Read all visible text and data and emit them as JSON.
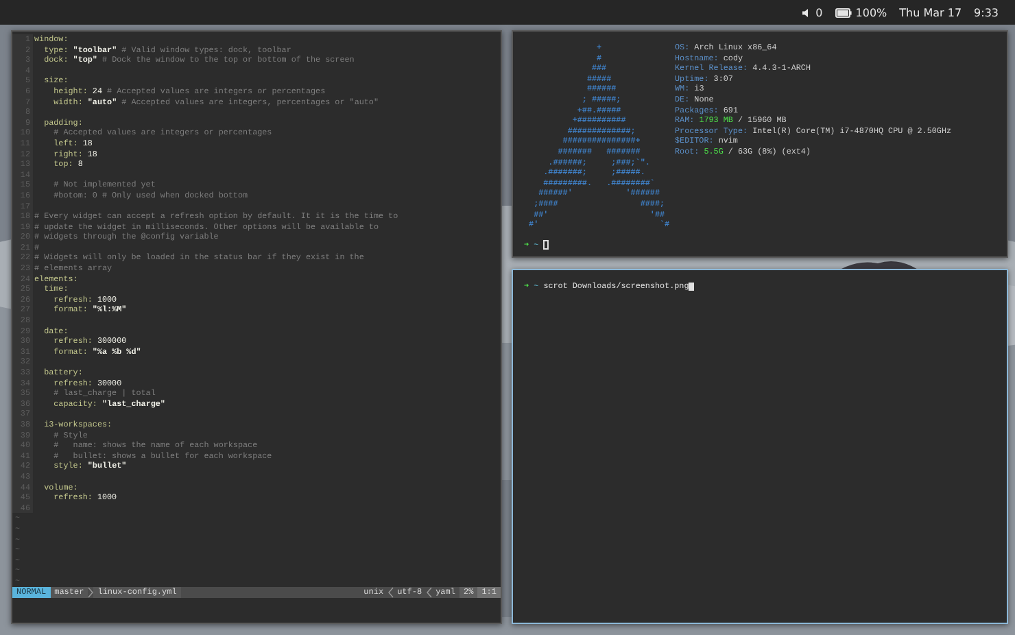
{
  "top_bar": {
    "volume": "0",
    "battery": "100%",
    "date": "Thu Mar 17",
    "time": "9:33"
  },
  "editor": {
    "lines": [
      {
        "number": "1",
        "parts": [
          {
            "kind": "key",
            "text": "window:"
          }
        ]
      },
      {
        "number": "2",
        "parts": [
          {
            "kind": "key",
            "text": "  type:"
          },
          {
            "kind": "str",
            "text": " \"toolbar\""
          },
          {
            "kind": "com",
            "text": " # Valid window types: dock, toolbar"
          }
        ]
      },
      {
        "number": "3",
        "parts": [
          {
            "kind": "key",
            "text": "  dock:"
          },
          {
            "kind": "str",
            "text": " \"top\""
          },
          {
            "kind": "com",
            "text": " # Dock the window to the top or bottom of the screen"
          }
        ]
      },
      {
        "number": "4"
      },
      {
        "number": "5",
        "parts": [
          {
            "kind": "key",
            "text": "  size:"
          }
        ]
      },
      {
        "number": "6",
        "parts": [
          {
            "kind": "key",
            "text": "    height:"
          },
          {
            "kind": "num",
            "text": " 24"
          },
          {
            "kind": "com",
            "text": " # Accepted values are integers or percentages"
          }
        ]
      },
      {
        "number": "7",
        "parts": [
          {
            "kind": "key",
            "text": "    width:"
          },
          {
            "kind": "str",
            "text": " \"auto\""
          },
          {
            "kind": "com",
            "text": " # Accepted values are integers, percentages or \"auto\""
          }
        ]
      },
      {
        "number": "8"
      },
      {
        "number": "9",
        "parts": [
          {
            "kind": "key",
            "text": "  padding:"
          }
        ]
      },
      {
        "number": "10",
        "parts": [
          {
            "kind": "com",
            "text": "    # Accepted values are integers or percentages"
          }
        ]
      },
      {
        "number": "11",
        "parts": [
          {
            "kind": "key",
            "text": "    left:"
          },
          {
            "kind": "num",
            "text": " 18"
          }
        ]
      },
      {
        "number": "12",
        "parts": [
          {
            "kind": "key",
            "text": "    right:"
          },
          {
            "kind": "num",
            "text": " 18"
          }
        ]
      },
      {
        "number": "13",
        "parts": [
          {
            "kind": "key",
            "text": "    top:"
          },
          {
            "kind": "num",
            "text": " 8"
          }
        ]
      },
      {
        "number": "14"
      },
      {
        "number": "15",
        "parts": [
          {
            "kind": "com",
            "text": "    # Not implemented yet"
          }
        ]
      },
      {
        "number": "16",
        "parts": [
          {
            "kind": "com",
            "text": "    #botom: 0 # Only used when docked bottom"
          }
        ]
      },
      {
        "number": "17"
      },
      {
        "number": "18",
        "parts": [
          {
            "kind": "com",
            "text": "# Every widget can accept a refresh option by default. It it is the time to"
          }
        ]
      },
      {
        "number": "19",
        "parts": [
          {
            "kind": "com",
            "text": "# update the widget in milliseconds. Other options will be available to"
          }
        ]
      },
      {
        "number": "20",
        "parts": [
          {
            "kind": "com",
            "text": "# widgets through the @config variable"
          }
        ]
      },
      {
        "number": "21",
        "parts": [
          {
            "kind": "com",
            "text": "#"
          }
        ]
      },
      {
        "number": "22",
        "parts": [
          {
            "kind": "com",
            "text": "# Widgets will only be loaded in the status bar if they exist in the"
          }
        ]
      },
      {
        "number": "23",
        "parts": [
          {
            "kind": "com",
            "text": "# elements array"
          }
        ]
      },
      {
        "number": "24",
        "parts": [
          {
            "kind": "key",
            "text": "elements:"
          }
        ]
      },
      {
        "number": "25",
        "parts": [
          {
            "kind": "key",
            "text": "  time:"
          }
        ]
      },
      {
        "number": "26",
        "parts": [
          {
            "kind": "key",
            "text": "    refresh:"
          },
          {
            "kind": "num",
            "text": " 1000"
          }
        ]
      },
      {
        "number": "27",
        "parts": [
          {
            "kind": "key",
            "text": "    format:"
          },
          {
            "kind": "str",
            "text": " \"%l:%M\""
          }
        ]
      },
      {
        "number": "28"
      },
      {
        "number": "29",
        "parts": [
          {
            "kind": "key",
            "text": "  date:"
          }
        ]
      },
      {
        "number": "30",
        "parts": [
          {
            "kind": "key",
            "text": "    refresh:"
          },
          {
            "kind": "num",
            "text": " 300000"
          }
        ]
      },
      {
        "number": "31",
        "parts": [
          {
            "kind": "key",
            "text": "    format:"
          },
          {
            "kind": "str",
            "text": " \"%a %b %d\""
          }
        ]
      },
      {
        "number": "32"
      },
      {
        "number": "33",
        "parts": [
          {
            "kind": "key",
            "text": "  battery:"
          }
        ]
      },
      {
        "number": "34",
        "parts": [
          {
            "kind": "key",
            "text": "    refresh:"
          },
          {
            "kind": "num",
            "text": " 30000"
          }
        ]
      },
      {
        "number": "35",
        "parts": [
          {
            "kind": "com",
            "text": "    # last_charge | total"
          }
        ]
      },
      {
        "number": "36",
        "parts": [
          {
            "kind": "key",
            "text": "    capacity:"
          },
          {
            "kind": "str",
            "text": " \"last_charge\""
          }
        ]
      },
      {
        "number": "37"
      },
      {
        "number": "38",
        "parts": [
          {
            "kind": "key",
            "text": "  i3-workspaces:"
          }
        ]
      },
      {
        "number": "39",
        "parts": [
          {
            "kind": "com",
            "text": "    # Style"
          }
        ]
      },
      {
        "number": "40",
        "parts": [
          {
            "kind": "com",
            "text": "    #   name: shows the name of each workspace"
          }
        ]
      },
      {
        "number": "41",
        "parts": [
          {
            "kind": "com",
            "text": "    #   bullet: shows a bullet for each workspace"
          }
        ]
      },
      {
        "number": "42",
        "parts": [
          {
            "kind": "key",
            "text": "    style:"
          },
          {
            "kind": "str",
            "text": " \"bullet\""
          }
        ]
      },
      {
        "number": "43"
      },
      {
        "number": "44",
        "parts": [
          {
            "kind": "key",
            "text": "  volume:"
          }
        ]
      },
      {
        "number": "45",
        "parts": [
          {
            "kind": "key",
            "text": "    refresh:"
          },
          {
            "kind": "num",
            "text": " 1000"
          }
        ]
      },
      {
        "number": "46"
      }
    ],
    "filler": [
      "~",
      "~",
      "~",
      "~",
      "~",
      "~",
      "~"
    ],
    "status_line": {
      "mode": "NORMAL",
      "branch": "master",
      "file": "linux-config.yml",
      "format": "unix",
      "encoding": "utf-8",
      "filetype": "yaml",
      "percent": "2%",
      "position": "1:1"
    }
  },
  "terminals": [
    {
      "focused": false,
      "logo": [
        "               +",
        "               #",
        "              ###",
        "             #####",
        "             ######",
        "            ; #####;",
        "           +##.#####",
        "          +##########",
        "         #############;",
        "        ###############+",
        "       #######   #######",
        "     .######;     ;###;`\".",
        "    .#######;     ;#####.",
        "    #########.   .########`",
        "   ######'           '######",
        "  ;####                 ####;",
        "  ##'                     '##",
        " #'                         `#"
      ],
      "info": [
        {
          "label": "OS:",
          "parts": [
            {
              "kind": "value",
              "text": "Arch Linux x86_64"
            }
          ]
        },
        {
          "label": "Hostname:",
          "parts": [
            {
              "kind": "value",
              "text": "cody"
            }
          ]
        },
        {
          "label": "Kernel Release:",
          "parts": [
            {
              "kind": "value",
              "text": "4.4.3-1-ARCH"
            }
          ]
        },
        {
          "label": "Uptime:",
          "parts": [
            {
              "kind": "value",
              "text": "3:07"
            }
          ]
        },
        {
          "label": "WM:",
          "parts": [
            {
              "kind": "value",
              "text": "i3"
            }
          ]
        },
        {
          "label": "DE:",
          "parts": [
            {
              "kind": "value",
              "text": "None"
            }
          ]
        },
        {
          "label": "Packages:",
          "parts": [
            {
              "kind": "value",
              "text": "691"
            }
          ]
        },
        {
          "label": "RAM:",
          "parts": [
            {
              "kind": "good",
              "text": "1793 MB"
            },
            {
              "kind": "value",
              "text": " / 15960 MB"
            }
          ]
        },
        {
          "label": "Processor Type:",
          "parts": [
            {
              "kind": "value",
              "text": "Intel(R) Core(TM) i7-4870HQ CPU @ 2.50GHz"
            }
          ]
        },
        {
          "label": "$EDITOR:",
          "parts": [
            {
              "kind": "value",
              "text": "nvim"
            }
          ]
        },
        {
          "label": "Root:",
          "parts": [
            {
              "kind": "good",
              "text": "5.5G"
            },
            {
              "kind": "value",
              "text": " / 63G (8%) (ext4)"
            }
          ]
        }
      ],
      "prompt": {
        "arrow": "➜",
        "dir": "~"
      }
    },
    {
      "focused": true,
      "prompt": {
        "arrow": "➜",
        "dir": "~",
        "command": "scrot Downloads/screenshot.png"
      }
    }
  ]
}
